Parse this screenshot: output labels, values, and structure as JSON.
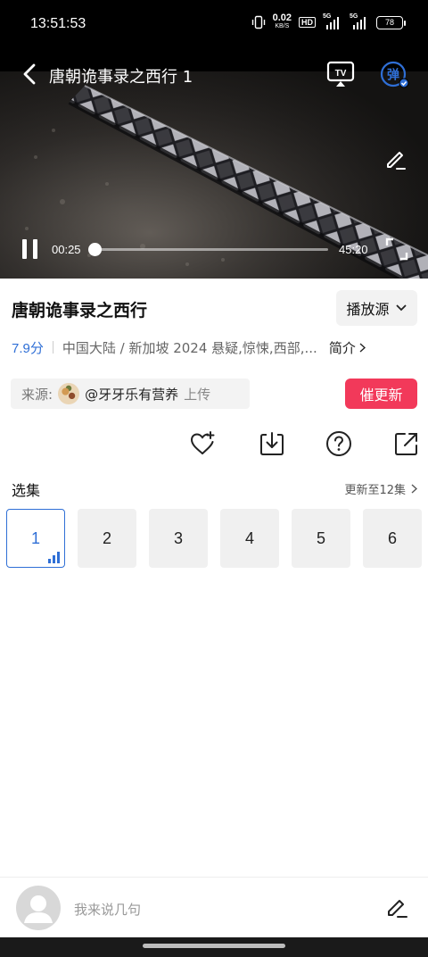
{
  "status_bar": {
    "time": "13:51:53",
    "net_speed_value": "0.02",
    "net_speed_unit": "KB/S",
    "hd_label": "HD",
    "signal1_label": "5G",
    "signal2_label": "5G",
    "battery": "78"
  },
  "player": {
    "title": "唐朝诡事录之西行 1",
    "tv_icon_label": "TV",
    "danmu_label": "弹",
    "current_time": "00:25",
    "total_time": "45:20",
    "progress": 0.0092
  },
  "info": {
    "show_title": "唐朝诡事录之西行",
    "source_button": "播放源",
    "rating": "7.9分",
    "meta": "中国大陆 / 新加坡  2024  悬疑,惊悚,西部,...",
    "intro": "简介"
  },
  "uploader": {
    "label": "来源:",
    "name": "@牙牙乐有营养",
    "action": "上传"
  },
  "urge_button": "催更新",
  "actions": [
    "favorite-add",
    "download",
    "help",
    "share"
  ],
  "episodes": {
    "heading": "选集",
    "updated": "更新至12集",
    "items": [
      {
        "label": "1",
        "active": true
      },
      {
        "label": "2",
        "active": false
      },
      {
        "label": "3",
        "active": false
      },
      {
        "label": "4",
        "active": false
      },
      {
        "label": "5",
        "active": false
      },
      {
        "label": "6",
        "active": false
      }
    ]
  },
  "comment": {
    "placeholder": "我来说几句"
  },
  "colors": {
    "accent_blue": "#2f6fd6",
    "urge_red": "#f2395a"
  }
}
